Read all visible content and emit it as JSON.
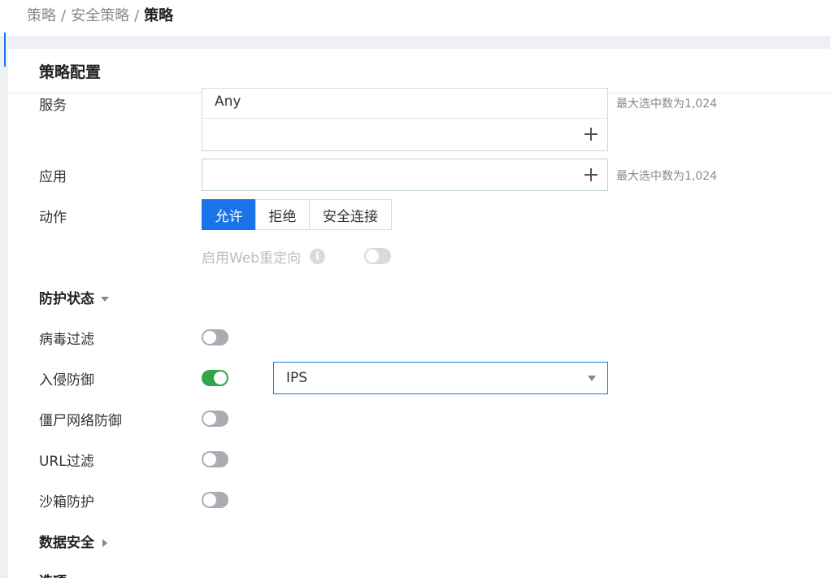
{
  "breadcrumb": {
    "item1": "策略",
    "sep": "/",
    "item2": "安全策略",
    "current": "策略"
  },
  "panel": {
    "title": "策略配置"
  },
  "service": {
    "label": "服务",
    "value": "Any",
    "hint": "最大选中数为1,024"
  },
  "application": {
    "label": "应用",
    "value": "",
    "hint": "最大选中数为1,024"
  },
  "action": {
    "label": "动作",
    "options": [
      "允许",
      "拒绝",
      "安全连接"
    ],
    "selected": "允许"
  },
  "web_redirect": {
    "label": "启用Web重定向",
    "info_icon": "info-icon",
    "enabled": false,
    "disabled": true
  },
  "protection": {
    "title": "防护状态",
    "items": [
      {
        "label": "病毒过滤",
        "on": false
      },
      {
        "label": "入侵防御",
        "on": true,
        "profile": "IPS"
      },
      {
        "label": "僵尸网络防御",
        "on": false
      },
      {
        "label": "URL过滤",
        "on": false
      },
      {
        "label": "沙箱防护",
        "on": false
      }
    ]
  },
  "data_security": {
    "title": "数据安全"
  },
  "options": {
    "title": "选项"
  },
  "colors": {
    "accent": "#1a73e8",
    "toggle_on": "#2ea64a",
    "toggle_off": "#a9adb3"
  }
}
